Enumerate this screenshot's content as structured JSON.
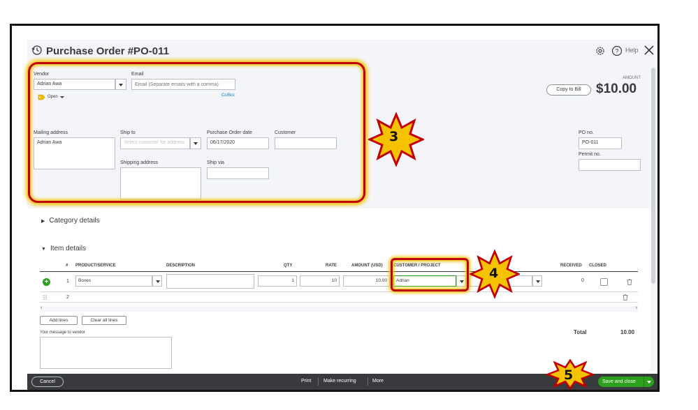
{
  "window": {
    "title": "Purchase Order #PO-011",
    "help_label": "Help"
  },
  "vendor": {
    "label": "Vendor",
    "value": "Adrian Awa",
    "status": "Open"
  },
  "email": {
    "label": "Email",
    "placeholder": "Email (Separate emails with a comma)",
    "cc_bcc": "Cc/Bcc"
  },
  "amount": {
    "label": "AMOUNT",
    "value": "$10.00",
    "copy_to_bill": "Copy to Bill"
  },
  "mailing_address": {
    "label": "Mailing address",
    "value": "Adrian Awa"
  },
  "ship_to": {
    "label": "Ship to",
    "placeholder": "Select customer for address"
  },
  "shipping_address": {
    "label": "Shipping address"
  },
  "po_date": {
    "label": "Purchase Order date",
    "value": "06/17/2020"
  },
  "ship_via": {
    "label": "Ship via"
  },
  "customer": {
    "label": "Customer"
  },
  "po_no": {
    "label": "PO no.",
    "value": "PO-011"
  },
  "permit_no": {
    "label": "Permit no."
  },
  "sections": {
    "category": "Category details",
    "item": "Item details"
  },
  "table": {
    "headers": {
      "num": "#",
      "product": "PRODUCT/SERVICE",
      "description": "DESCRIPTION",
      "qty": "QTY",
      "rate": "RATE",
      "amount": "AMOUNT (USD)",
      "customer": "CUSTOMER / PROJECT",
      "received": "RECEIVED",
      "closed": "CLOSED"
    },
    "rows": [
      {
        "num": "1",
        "product": "Boxes",
        "qty": "1",
        "rate": "10",
        "amount": "10.00",
        "customer": "Adrian",
        "received": "0"
      },
      {
        "num": "2"
      }
    ],
    "add_lines": "Add lines",
    "clear_lines": "Clear all lines"
  },
  "message": {
    "label": "Your message to vendor"
  },
  "total": {
    "label": "Total",
    "value": "10.00"
  },
  "footer": {
    "cancel": "Cancel",
    "print": "Print",
    "make_recurring": "Make recurring",
    "more": "More",
    "save_close": "Save and close"
  },
  "callouts": [
    "3",
    "4",
    "5"
  ],
  "colors": {
    "green": "#2ca01c",
    "callout_fill": "#f5c200",
    "callout_border": "#c00000",
    "footer": "#393a3d",
    "link": "#0077c5"
  }
}
